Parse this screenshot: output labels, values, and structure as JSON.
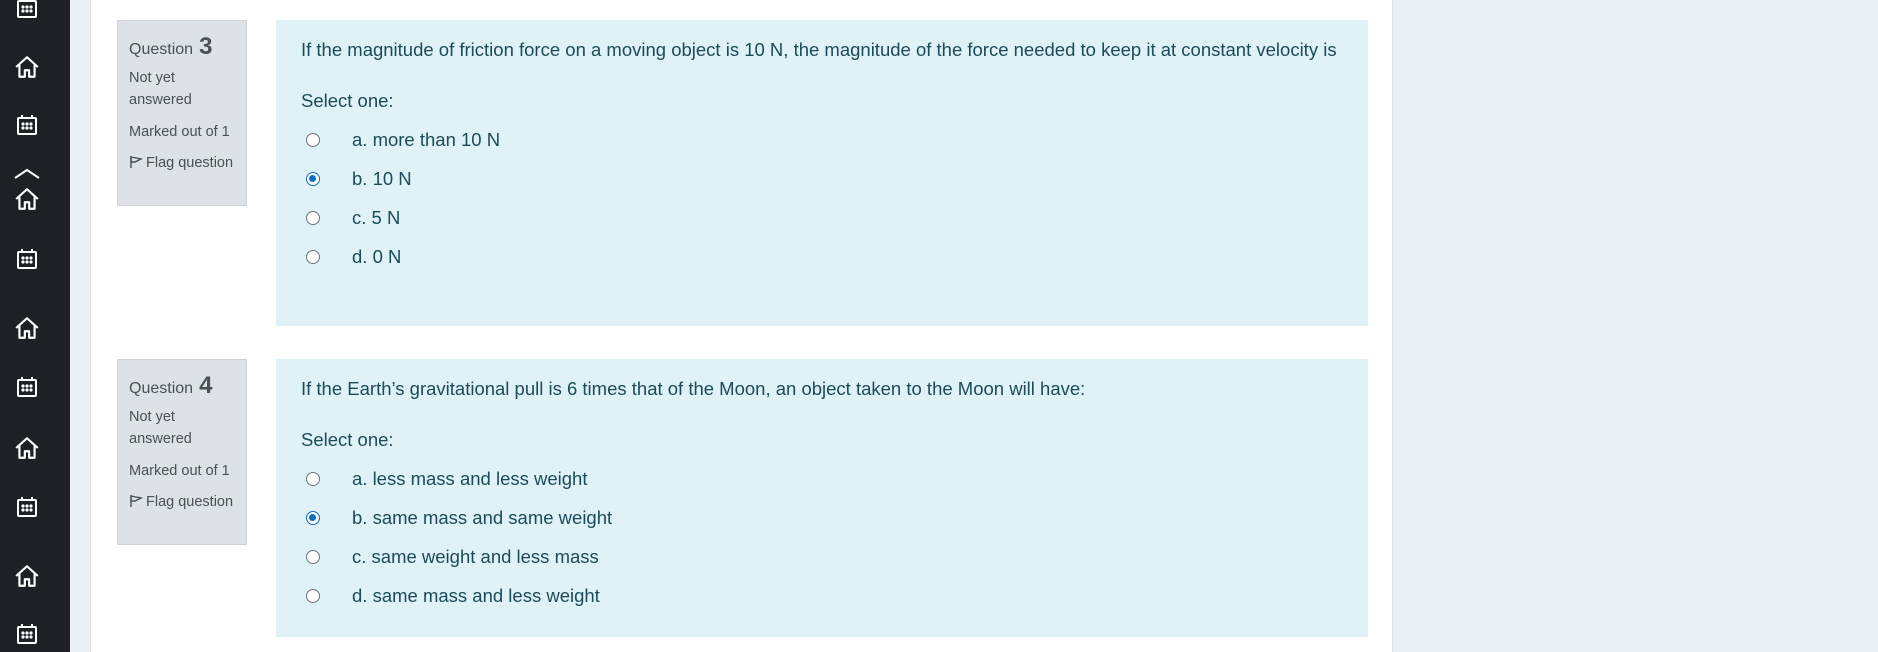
{
  "sidebar": {
    "icons": [
      {
        "name": "calendar-icon"
      },
      {
        "name": "home-icon"
      },
      {
        "name": "calendar-icon"
      },
      {
        "name": "chevron-up-icon"
      },
      {
        "name": "home-icon"
      },
      {
        "name": "calendar-icon"
      },
      {
        "name": "home-icon"
      },
      {
        "name": "calendar-icon"
      },
      {
        "name": "home-icon"
      },
      {
        "name": "calendar-icon"
      },
      {
        "name": "home-icon"
      },
      {
        "name": "calendar-icon"
      }
    ]
  },
  "questions": [
    {
      "label": "Question",
      "number": "3",
      "state": "Not yet answered",
      "grade": "Marked out of 1",
      "flag_label": "Flag question",
      "text": "If the magnitude of friction force on a moving object is 10 N, the magnitude of the force needed to keep it at constant velocity is",
      "prompt": "Select one:",
      "options": [
        {
          "label": "a. more than 10 N",
          "selected": false
        },
        {
          "label": "b. 10 N",
          "selected": true
        },
        {
          "label": "c. 5 N",
          "selected": false
        },
        {
          "label": "d. 0 N",
          "selected": false
        }
      ]
    },
    {
      "label": "Question",
      "number": "4",
      "state": "Not yet answered",
      "grade": "Marked out of 1",
      "flag_label": "Flag question",
      "text": "If the Earth’s gravitational pull is 6 times that of the Moon, an object taken to the Moon will have:",
      "prompt": "Select one:",
      "options": [
        {
          "label": "a. less mass and less weight",
          "selected": false
        },
        {
          "label": "b. same mass and same weight",
          "selected": true
        },
        {
          "label": "c. same weight and less mass",
          "selected": false
        },
        {
          "label": "d. same mass and less weight",
          "selected": false
        }
      ]
    }
  ],
  "colors": {
    "sidebar_bg": "#1d2125",
    "question_bg": "#def2f8",
    "info_bg": "#dee2e6",
    "radio_accent": "#0f6cbf"
  }
}
